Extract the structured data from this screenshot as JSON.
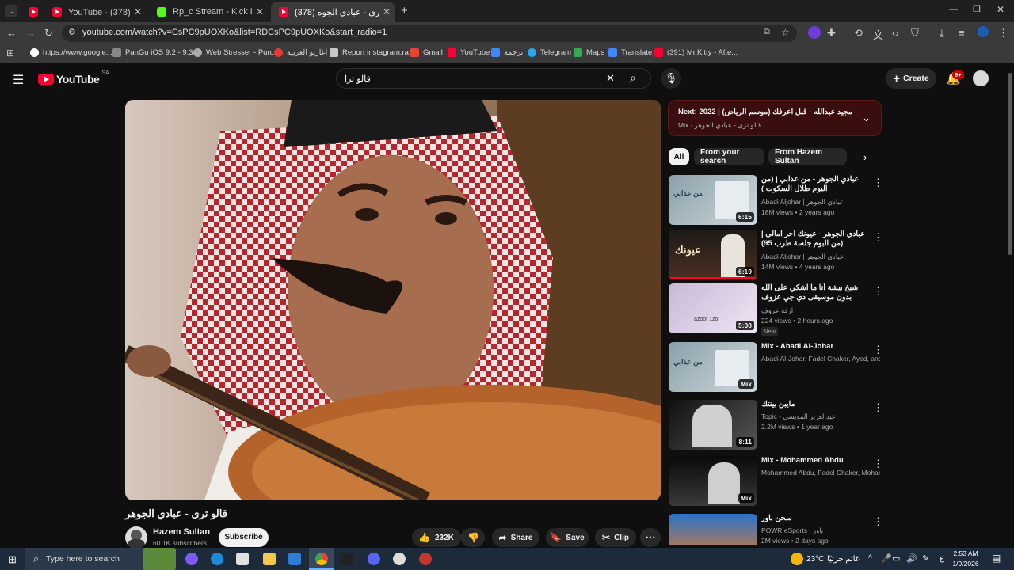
{
  "browser": {
    "tabs": [
      {
        "title": "",
        "favicon": "youtube-icon"
      },
      {
        "title": "YouTube - سجن باور (378)",
        "favicon": "youtube-icon"
      },
      {
        "title": "Rp_c Stream - Kick Dashboard",
        "favicon": "kick-icon"
      },
      {
        "title": "(378) قالو ترى - عبادي الجوه...",
        "favicon": "youtube-icon"
      }
    ],
    "url": "youtube.com/watch?v=CsPC9pUOXKo&list=RDCsPC9pUOXKo&start_radio=1",
    "bookmarks": [
      "https://www.google...",
      "PanGu iOS 9.2 - 9.3....",
      "Web Stresser - Purc...",
      "اغاريو العربية",
      "Report instagram.ra...",
      "Gmail",
      "YouTube",
      "ترجمة",
      "Telegram",
      "Maps",
      "Translate",
      "(391) Mr.Kitty - Afte..."
    ]
  },
  "youtube": {
    "logo_text": "YouTube",
    "region": "SA",
    "search_value": "قالو ترا",
    "create_label": "Create",
    "notification_count": "9+",
    "video_title": "قالو ترى - عبادي الجوهر",
    "channel_name": "Hazem Sultan",
    "subscribers": "60.1K subscribers",
    "subscribe_label": "Subscribe",
    "likes": "232K",
    "share_label": "Share",
    "save_label": "Save",
    "clip_label": "Clip",
    "next_label": "Next:",
    "next_title": "2022 | عبدالمجيد عبدالله - قبل اعرفك (موسم الرياض) | Abd...",
    "next_sub": "Mix - قالو ترى - عبادي الجوهر",
    "chips": [
      "All",
      "From your search",
      "From Hazem Sultan"
    ],
    "recommendations": [
      {
        "title": "عبادي الجوهر - من عذابي | (من البوم طلال السكوت )",
        "channel": "Abadi Aljohar | عبادي الجوهر",
        "meta": "18M views • 2 years ago",
        "duration": "6:15",
        "thumb_text": "من عذابي"
      },
      {
        "title": "عبادي الجوهر - عيونك آخر آمالي | (من البوم جلسة طرب 95)",
        "channel": "Abadi Aljohar | عبادي الجوهر",
        "meta": "14M views • 4 years ago",
        "duration": "6:19",
        "thumb_text": "عيونك"
      },
      {
        "title": "شيخ بيشة أنا ما اشكي على الله بدون موسيقى دي جي عزوف",
        "channel": "ازفة عزوف",
        "meta": "224 views • 2 hours ago",
        "duration": "5:00",
        "badge": "New",
        "thumb_text": "azoof 1zo"
      },
      {
        "title": "Mix - Abadi Al-Johar",
        "channel": "Abadi Al-Johar, Fadel Chaker, Ayed, and ...",
        "meta": "",
        "duration": "Mix",
        "thumb_text": "من عذابي"
      },
      {
        "title": "مايبن بينتك",
        "channel": "Topic - عبدالعزيز المويسي",
        "meta": "2.2M views • 1 year ago",
        "duration": "8:11",
        "thumb_text": ""
      },
      {
        "title": "Mix - Mohammed Abdu",
        "channel": "Mohammed Abdu, Fadel Chaker, Moham...",
        "meta": "",
        "duration": "Mix",
        "thumb_text": ""
      },
      {
        "title": "سجن باور",
        "channel": "POWR eSports | باور",
        "meta": "2M views • 2 days ago",
        "duration": "",
        "thumb_text": ""
      }
    ]
  },
  "taskbar": {
    "search_placeholder": "Type here to search",
    "weather": "23°C",
    "weather_text": "غائم جزئيًا",
    "lang": "ع",
    "time": "2:53 AM",
    "date": "1/9/2026"
  },
  "colors": {
    "youtube_red": "#ff0033",
    "bg": "#0f0f0f",
    "chip": "#272727"
  }
}
